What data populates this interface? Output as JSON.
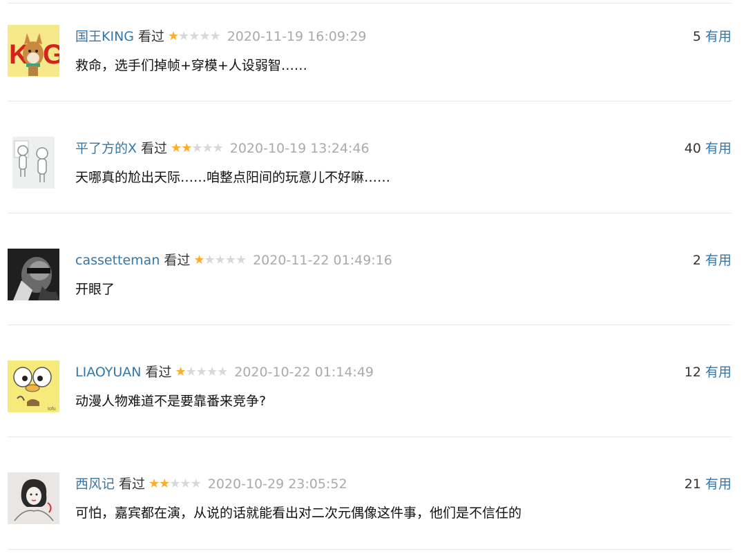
{
  "comments": [
    {
      "user": "国王KING",
      "status": "看过",
      "rating": 1,
      "max_rating": 5,
      "time": "2020-11-19 16:09:29",
      "votes": "5",
      "vote_label": "有用",
      "text": "救命，选手们掉帧+穿模+人设弱智……",
      "avatar_icon": "king-dog-avatar"
    },
    {
      "user": "平了方的X",
      "status": "看过",
      "rating": 2,
      "max_rating": 5,
      "time": "2020-10-19 13:24:46",
      "votes": "40",
      "vote_label": "有用",
      "text": "天哪真的尬出天际……咱整点阳间的玩意儿不好嘛……",
      "avatar_icon": "sketch-figures-avatar"
    },
    {
      "user": "cassetteman",
      "status": "看过",
      "rating": 1,
      "max_rating": 5,
      "time": "2020-11-22 01:49:16",
      "votes": "2",
      "vote_label": "有用",
      "text": "开眼了",
      "avatar_icon": "bw-portrait-avatar"
    },
    {
      "user": "LIAOYUAN",
      "status": "看过",
      "rating": 1,
      "max_rating": 5,
      "time": "2020-10-22 01:14:49",
      "votes": "12",
      "vote_label": "有用",
      "text": "动漫人物难道不是要靠番来竞争?",
      "avatar_icon": "yellow-cartoon-avatar"
    },
    {
      "user": "西风记",
      "status": "看过",
      "rating": 2,
      "max_rating": 5,
      "time": "2020-10-29 23:05:52",
      "votes": "21",
      "vote_label": "有用",
      "text": "可怕，嘉宾都在演，从说的话就能看出对二次元偶像这件事，他们是不信任的",
      "avatar_icon": "sketch-girl-avatar"
    }
  ],
  "colors": {
    "link": "#3377aa",
    "star_on": "#ffac2d",
    "star_off": "#d8d8d8",
    "time": "#aaaaaa",
    "divider": "#e8e8e8"
  }
}
